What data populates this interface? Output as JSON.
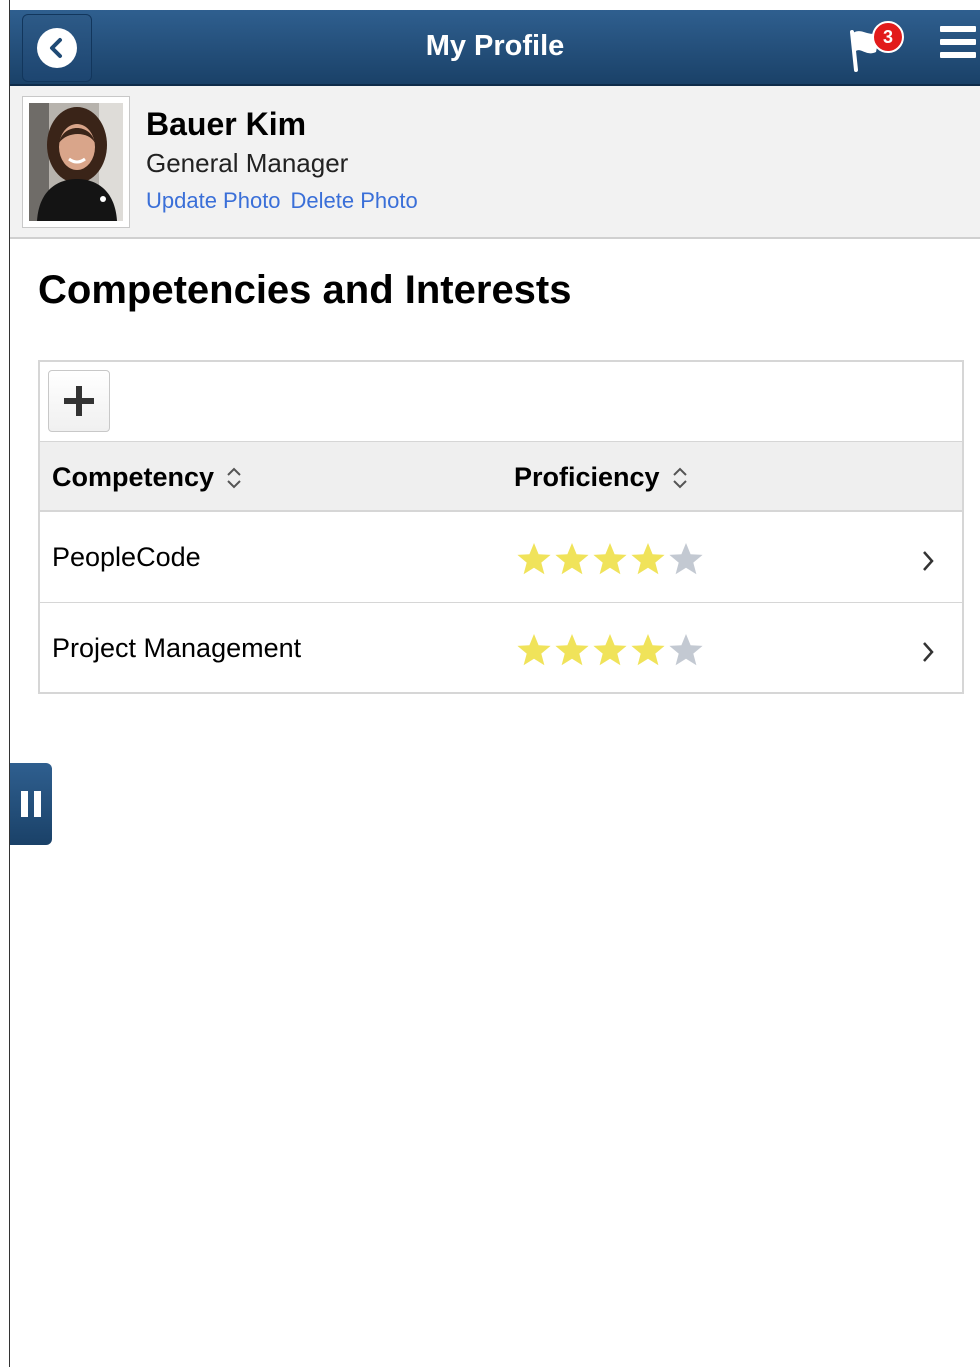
{
  "header": {
    "title": "My Profile",
    "notification_count": "3",
    "icons": {
      "back": "back-chevron-icon",
      "flag": "flag-icon",
      "menu": "hamburger-menu-icon"
    },
    "color": "#1f4a75"
  },
  "profile": {
    "name": "Bauer Kim",
    "job_title": "General Manager",
    "update_photo_label": "Update Photo",
    "delete_photo_label": "Delete Photo",
    "link_color": "#3a6fd8"
  },
  "section": {
    "title": "Competencies and Interests"
  },
  "grid": {
    "add_icon": "plus-icon",
    "columns": [
      {
        "label": "Competency",
        "sort_icon": "sort-toggle-icon"
      },
      {
        "label": "Proficiency",
        "sort_icon": "sort-toggle-icon"
      }
    ],
    "rows": [
      {
        "competency": "PeopleCode",
        "proficiency_stars": 4,
        "max_stars": 5
      },
      {
        "competency": "Project Management",
        "proficiency_stars": 4,
        "max_stars": 5
      }
    ],
    "star_filled_color": "#f0e35a",
    "star_empty_color": "#c3c9d2"
  },
  "side_tab": {
    "icon": "pause-icon"
  }
}
